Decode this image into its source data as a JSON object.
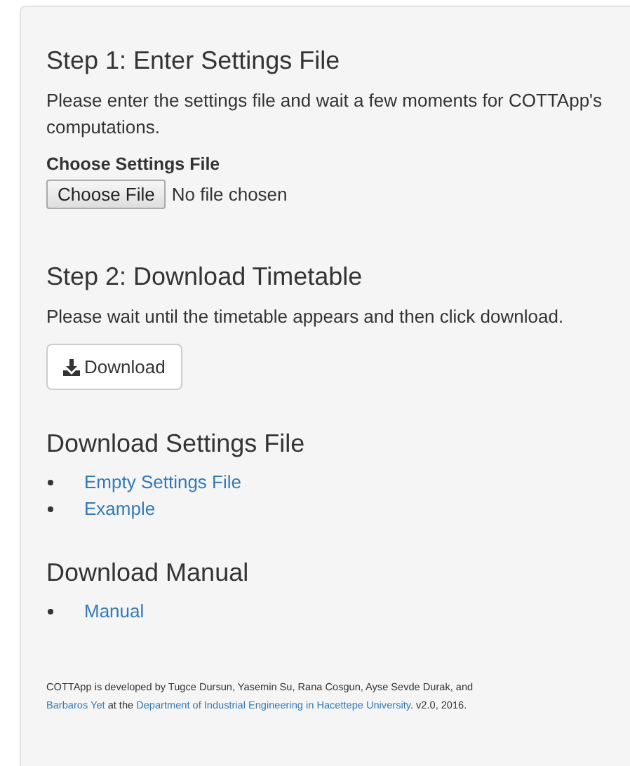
{
  "step1": {
    "title": "Step 1: Enter Settings File",
    "text": "Please enter the settings file and wait a few moments for COTTApp's computations.",
    "label": "Choose Settings File",
    "file_button": "Choose File",
    "file_status": "No file chosen"
  },
  "step2": {
    "title": "Step 2: Download Timetable",
    "text": "Please wait until the timetable appears and then click download.",
    "button": "Download"
  },
  "settings_downloads": {
    "title": "Download Settings File",
    "links": [
      "Empty Settings File",
      "Example"
    ]
  },
  "manual_downloads": {
    "title": "Download Manual",
    "links": [
      "Manual"
    ]
  },
  "footer": {
    "lines": [
      [
        {
          "text": "COTTApp is developed by Tugce Dursun, Yasemin Su, Rana Cosgun, Ayse Sevde Durak, and",
          "link": false
        }
      ],
      [
        {
          "text": "Barbaros Yet",
          "link": true
        },
        {
          "text": " at the ",
          "link": false
        },
        {
          "text": "Department of Industrial Engineering in Hacettepe University",
          "link": true
        },
        {
          "text": ". v2.0, 2016.",
          "link": false
        }
      ]
    ]
  }
}
